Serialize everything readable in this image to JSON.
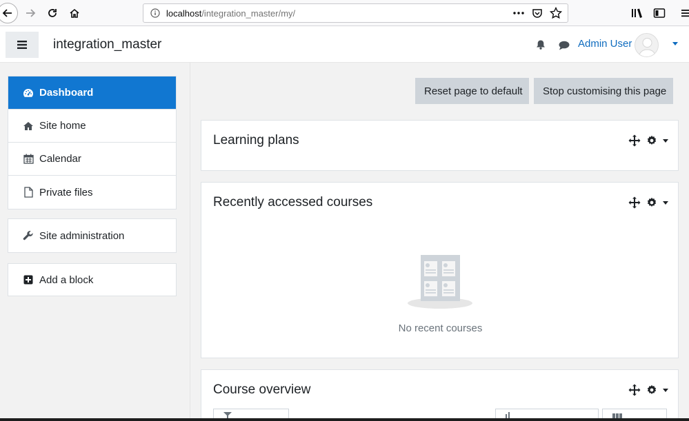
{
  "browser": {
    "url_host": "localhost",
    "url_path": "/integration_master/my/"
  },
  "navbar": {
    "site_name": "integration_master",
    "user_name": "Admin User"
  },
  "sidebar": {
    "items": [
      {
        "label": "Dashboard",
        "icon": "dashboard-icon"
      },
      {
        "label": "Site home",
        "icon": "home-icon"
      },
      {
        "label": "Calendar",
        "icon": "calendar-icon"
      },
      {
        "label": "Private files",
        "icon": "file-icon"
      }
    ],
    "admin": {
      "label": "Site administration",
      "icon": "wrench-icon"
    },
    "add_block": {
      "label": "Add a block",
      "icon": "plus-square-icon"
    }
  },
  "main": {
    "reset_label": "Reset page to default",
    "stop_label": "Stop customising this page",
    "blocks": [
      {
        "title": "Learning plans"
      },
      {
        "title": "Recently accessed courses",
        "empty_text": "No recent courses"
      },
      {
        "title": "Course overview"
      }
    ]
  },
  "colors": {
    "accent": "#1177d1",
    "link": "#0f6cbf",
    "button_gray": "#ced4da",
    "page_bg": "#f2f2f2"
  }
}
